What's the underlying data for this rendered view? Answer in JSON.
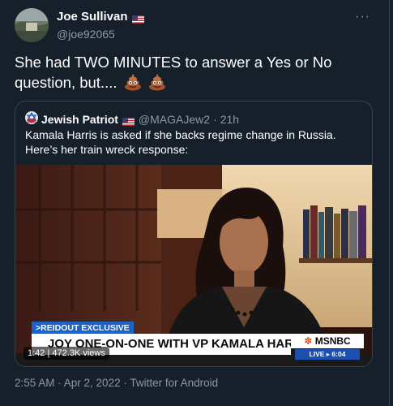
{
  "author": {
    "name": "Joe Sullivan",
    "handle": "@joe92065"
  },
  "tweet": {
    "text": "She had TWO MINUTES to answer a Yes or No question, but...."
  },
  "quote": {
    "name": "Jewish Patriot",
    "handle": "@MAGAJew2",
    "separator": "·",
    "time": "21h",
    "text": "Kamala Harris is asked if she backs regime change in Russia. Here’s her train wreck response:"
  },
  "video": {
    "chyron_tag": ">REIDOUT EXCLUSIVE",
    "chyron_main": "JOY ONE-ON-ONE WITH VP KAMALA HARRIS",
    "network": "MSNBC",
    "live_label": "LIVE ▸ 6:04",
    "duration": "1:42",
    "views": "472.3K views"
  },
  "footer": {
    "text": "2:55 AM · Apr 2, 2022 · Twitter for Android"
  },
  "colors": {
    "background": "#15202b",
    "secondary_text": "#8b98a5",
    "border": "#38444d"
  }
}
